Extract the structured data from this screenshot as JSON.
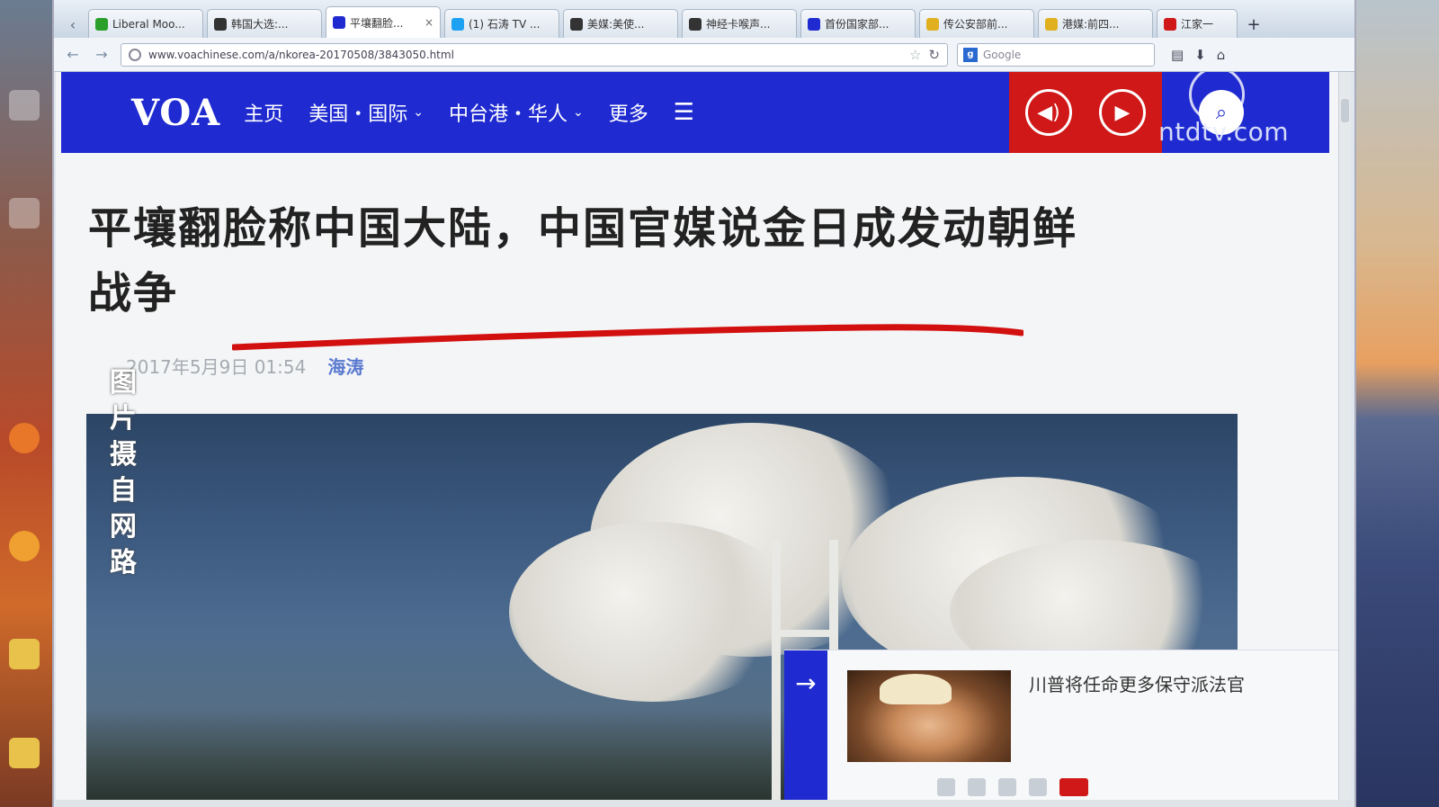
{
  "browser": {
    "tabs": [
      {
        "label": "Liberal Moo...",
        "fav_color": "#2aa02a"
      },
      {
        "label": "韩国大选:...",
        "fav_color": "#333333"
      },
      {
        "label": "平壤翻脸...",
        "fav_color": "#1f2bd0",
        "active": true
      },
      {
        "label": "(1) 石涛 TV ...",
        "fav_color": "#1da1f2"
      },
      {
        "label": "美媒:美使...",
        "fav_color": "#333333"
      },
      {
        "label": "神经卡喉声...",
        "fav_color": "#333333"
      },
      {
        "label": "首份国家部...",
        "fav_color": "#1f2bd0"
      },
      {
        "label": "传公安部前...",
        "fav_color": "#e0b020"
      },
      {
        "label": "港媒:前四...",
        "fav_color": "#e0b020"
      },
      {
        "label": "江家一",
        "fav_color": "#d01818"
      }
    ],
    "tab_close": "×",
    "tab_new": "+",
    "url": "www.voachinese.com/a/nkorea-20170508/3843050.html",
    "search_placeholder": "Google",
    "search_engine_letter": "g"
  },
  "site": {
    "logo": "VOA",
    "nav": [
      {
        "label": "主页",
        "has_chevron": false
      },
      {
        "label": "美国・国际",
        "has_chevron": true
      },
      {
        "label": "中台港・华人",
        "has_chevron": true
      },
      {
        "label": "更多",
        "has_chevron": false
      }
    ],
    "chevron": "⌄",
    "menu_glyph": "☰",
    "audio_glyph": "◀)",
    "play_glyph": "▶",
    "search_glyph": "⌕",
    "accent": "#1f2bd0",
    "media_red": "#d01818"
  },
  "watermark": "ntdtv.com",
  "article": {
    "title_line1": "平壤翻脸称中国大陆，中国官媒说金日成发动朝鲜",
    "title_line2": "战争",
    "date": "2017年5月9日 01:54",
    "author": "海涛",
    "photo_credit": "图片摄自网路"
  },
  "related": {
    "arrow": "→",
    "headline": "川普将任命更多保守派法官"
  }
}
